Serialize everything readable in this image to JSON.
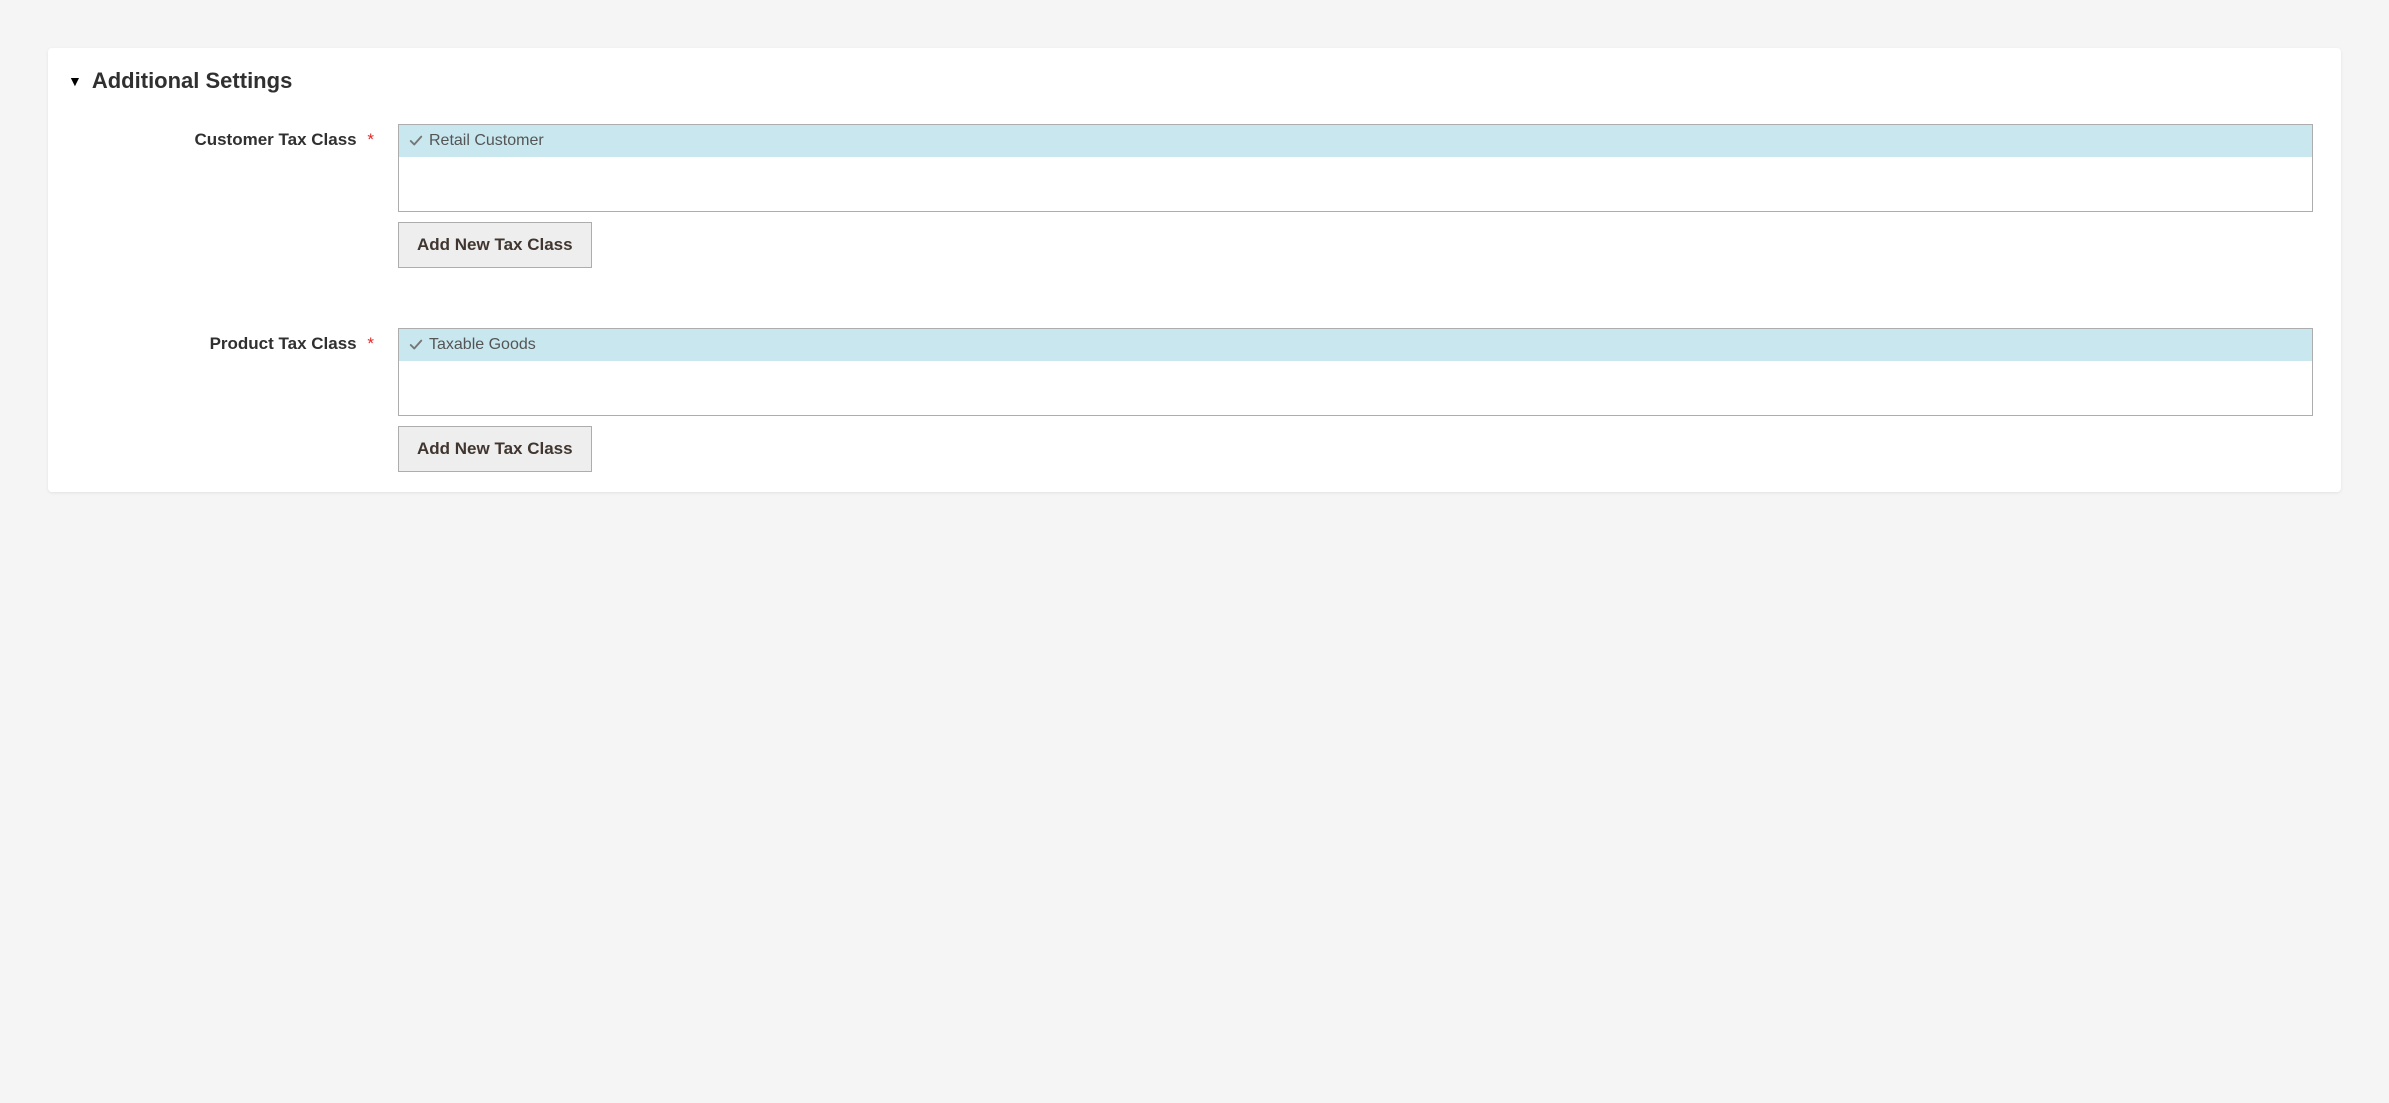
{
  "section": {
    "title": "Additional Settings"
  },
  "fields": {
    "customer": {
      "label": "Customer Tax Class",
      "required_mark": "*",
      "options": [
        {
          "label": "Retail Customer",
          "selected": true
        }
      ],
      "add_button": "Add New Tax Class"
    },
    "product": {
      "label": "Product Tax Class",
      "required_mark": "*",
      "options": [
        {
          "label": "Taxable Goods",
          "selected": true
        }
      ],
      "add_button": "Add New Tax Class"
    }
  }
}
